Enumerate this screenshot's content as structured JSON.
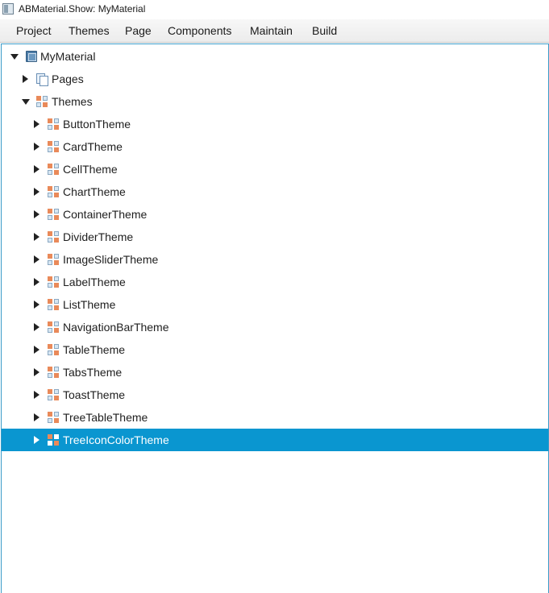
{
  "window": {
    "title": "ABMaterial.Show: MyMaterial"
  },
  "menubar": {
    "items": [
      "Project",
      "Themes",
      "Page",
      "Components",
      "Maintain",
      "Build"
    ]
  },
  "tree": {
    "root": {
      "label": "MyMaterial",
      "icon": "book-icon",
      "expanded": true
    },
    "pages": {
      "label": "Pages",
      "icon": "pages-icon",
      "expanded": false
    },
    "themes": {
      "label": "Themes",
      "icon": "theme-grid-icon",
      "expanded": true
    },
    "theme_items": [
      "ButtonTheme",
      "CardTheme",
      "CellTheme",
      "ChartTheme",
      "ContainerTheme",
      "DividerTheme",
      "ImageSliderTheme",
      "LabelTheme",
      "ListTheme",
      "NavigationBarTheme",
      "TableTheme",
      "TabsTheme",
      "ToastTheme",
      "TreeTableTheme",
      "TreeIconColorTheme"
    ],
    "selected": "TreeIconColorTheme"
  },
  "colors": {
    "selection": "#0a96d0",
    "border": "#3a9bc8",
    "theme_icon_accent": "#e98a5a"
  }
}
